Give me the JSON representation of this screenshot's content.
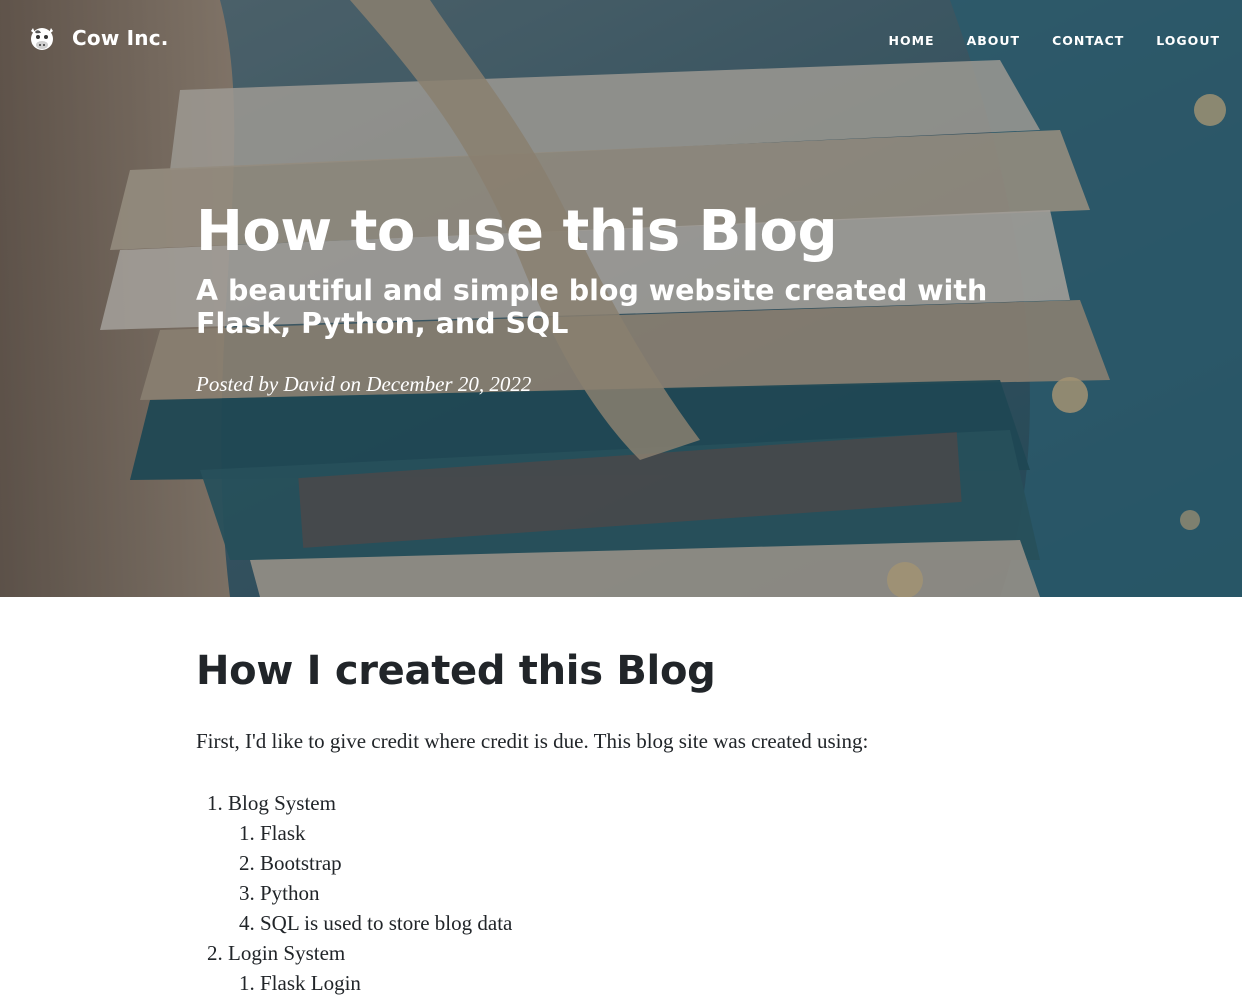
{
  "brand": {
    "name": "Cow Inc.",
    "logo_icon": "cow-logo-icon"
  },
  "nav": {
    "items": [
      "Home",
      "About",
      "Contact",
      "Logout"
    ]
  },
  "post": {
    "title": "How to use this Blog",
    "subtitle": "A beautiful and simple blog website created with Flask, Python, and SQL",
    "meta": "Posted by David on December 20, 2022"
  },
  "article": {
    "heading": "How I created this Blog",
    "intro": "First, I'd like to give credit where credit is due. This blog site was created using:",
    "list": [
      {
        "label": "Blog System",
        "children": [
          "Flask",
          "Bootstrap",
          "Python",
          "SQL is used to store blog data"
        ]
      },
      {
        "label": "Login System",
        "children": [
          "Flask Login"
        ]
      }
    ]
  },
  "colors": {
    "text": "#212529",
    "hero_overlay": "rgba(33,37,41,0.38)",
    "hero_tint": "#4a6f7d"
  }
}
